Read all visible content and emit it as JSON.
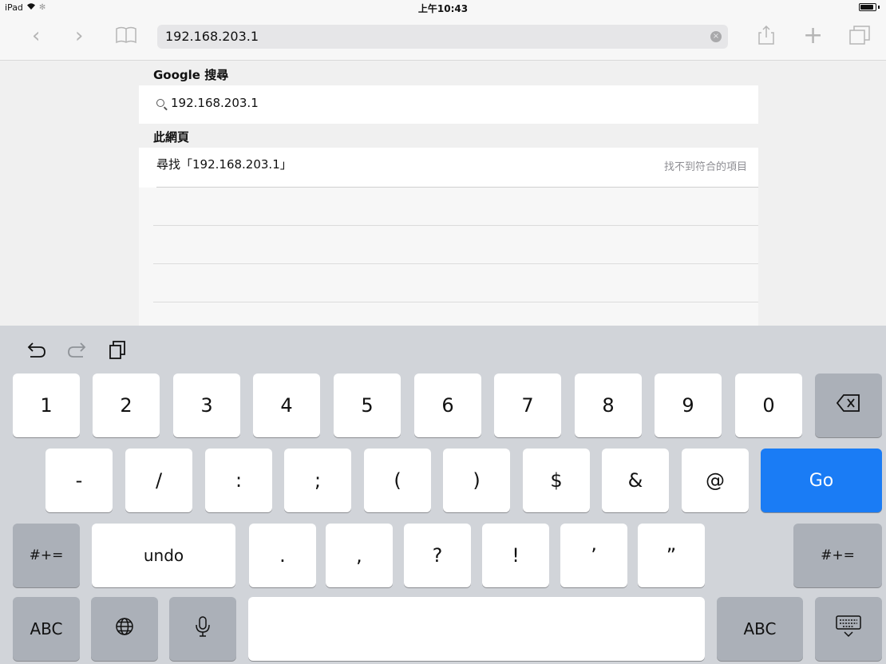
{
  "status_bar": {
    "device": "iPad",
    "wifi": "空",
    "time": "上午10:43"
  },
  "toolbar": {
    "back": "‹",
    "forward": "›",
    "bookmarks_icon": "book-icon",
    "url": "192.168.203.1",
    "clear": "×",
    "share_icon": "share-icon",
    "new_tab": "+",
    "tabs_icon": "tabs-icon"
  },
  "suggestions": {
    "google_header": "Google 搜尋",
    "google_query": "192.168.203.1",
    "page_header": "此網頁",
    "find_label": "尋找「192.168.203.1」",
    "find_result": "找不到符合的項目"
  },
  "keyboard": {
    "toolbar": {
      "undo_icon": "undo-icon",
      "redo_icon": "redo-icon",
      "paste_icon": "paste-icon"
    },
    "row1": [
      "1",
      "2",
      "3",
      "4",
      "5",
      "6",
      "7",
      "8",
      "9",
      "0"
    ],
    "row2": [
      "-",
      "/",
      ":",
      ";",
      "(",
      ")",
      "$",
      "&",
      "@"
    ],
    "go": "Go",
    "row3": [
      ".",
      ",",
      "?",
      "!",
      "’",
      "”"
    ],
    "symbols": "#+=",
    "undo": "undo",
    "abc": "ABC",
    "globe": "🌐",
    "mic": "🎙",
    "backspace": "⌫",
    "hide": "⌨"
  }
}
